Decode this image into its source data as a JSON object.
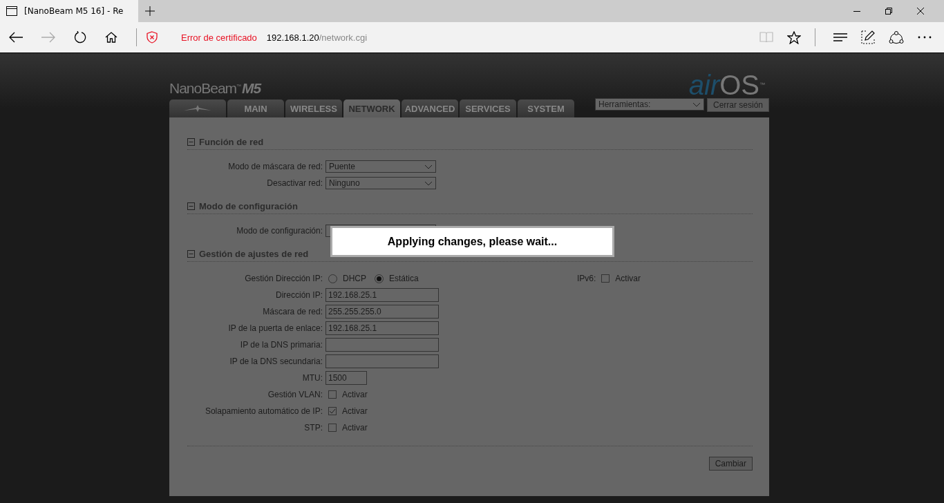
{
  "browser": {
    "tab_title": "[NanoBeam M5 16] - Re",
    "address": {
      "warning": "Error de certificado",
      "host": "192.168.1.20",
      "path": "/network.cgi"
    }
  },
  "header": {
    "product": "NanoBeam",
    "trademark": "™",
    "model": "M5",
    "brand_a": "air",
    "brand_b": "OS",
    "brand_tm": "™"
  },
  "tabs": [
    {
      "kind": "icon",
      "selected": false
    },
    {
      "kind": "text",
      "label": "MAIN",
      "selected": false
    },
    {
      "kind": "text",
      "label": "WIRELESS",
      "selected": false
    },
    {
      "kind": "text",
      "label": "NETWORK",
      "selected": true
    },
    {
      "kind": "text",
      "label": "ADVANCED",
      "selected": false
    },
    {
      "kind": "text",
      "label": "SERVICES",
      "selected": false
    },
    {
      "kind": "text",
      "label": "SYSTEM",
      "selected": false
    }
  ],
  "tools": {
    "select": "Herramientas:",
    "logout": "Cerrar sesión"
  },
  "sections": [
    {
      "title": "Función de red",
      "expanded": true,
      "rows": [
        {
          "kind": "select",
          "label": "Modo de máscara de red:",
          "value": "Puente"
        },
        {
          "kind": "select",
          "label": "Desactivar red:",
          "value": "Ninguno"
        }
      ]
    },
    {
      "title": "Modo de configuración",
      "expanded": true,
      "rows": [
        {
          "kind": "select",
          "label": "Modo de configuración:"
        }
      ]
    },
    {
      "title": "Gestión de ajustes de red",
      "expanded": true,
      "rows": [
        {
          "kind": "radio",
          "label": "Gestión Dirección IP:",
          "options": [
            {
              "label": "DHCP",
              "selected": false
            },
            {
              "label": "Estática",
              "selected": true
            }
          ],
          "side": {
            "label": "IPv6:",
            "option": "Activar",
            "checked": false
          }
        },
        {
          "kind": "text",
          "label": "Dirección IP:",
          "value": "192.168.25.1"
        },
        {
          "kind": "text",
          "label": "Máscara de red:",
          "value": "255.255.255.0"
        },
        {
          "kind": "text",
          "label": "IP de la puerta de enlace:",
          "value": "192.168.25.1"
        },
        {
          "kind": "text",
          "label": "IP de la DNS primaria:"
        },
        {
          "kind": "text",
          "label": "IP de la DNS secundaria:"
        },
        {
          "kind": "short",
          "label": "MTU:",
          "value": "1500"
        },
        {
          "kind": "checkbox",
          "label": "Gestión VLAN:",
          "option": "Activar",
          "checked": false
        },
        {
          "kind": "checkbox",
          "label": "Solapamiento automático de IP:",
          "option": "Activar",
          "checked": true
        },
        {
          "kind": "checkbox",
          "label": "STP:",
          "option": "Activar",
          "checked": false
        }
      ]
    }
  ],
  "submit": "Cambiar",
  "modal": "Applying changes, please wait..."
}
